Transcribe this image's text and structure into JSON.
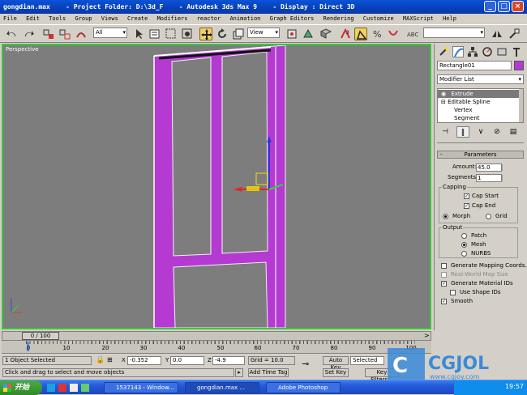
{
  "window": {
    "title": "gongdian.max    - Project Folder: D:\\3d_F    - Autodesk 3ds Max 9    - Display : Direct 3D",
    "min": "_",
    "max": "□",
    "close": "×"
  },
  "menu": [
    "File",
    "Edit",
    "Tools",
    "Group",
    "Views",
    "Create",
    "Modifiers",
    "reactor",
    "Animation",
    "Graph Editors",
    "Rendering",
    "Customize",
    "MAXScript",
    "Help"
  ],
  "toolbar": {
    "selection_filter": "All",
    "ref_coord": "View"
  },
  "viewport": {
    "label": "Perspective"
  },
  "command_panel": {
    "object_name": "Rectangle01",
    "modifier_list": "Modifier List",
    "stack": [
      "Extrude",
      "Editable Spline",
      "Vertex",
      "Segment"
    ],
    "rollout_title": "Parameters",
    "amount_label": "Amount:",
    "amount_value": "45.0",
    "segments_label": "Segments:",
    "segments_value": "1",
    "capping_title": "Capping",
    "cap_start": "Cap Start",
    "cap_end": "Cap End",
    "morph": "Morph",
    "grid": "Grid",
    "output_title": "Output",
    "patch": "Patch",
    "mesh": "Mesh",
    "nurbs": "NURBS",
    "gen_mapping": "Generate Mapping Coords.",
    "real_world": "Real-World Map Size",
    "gen_mat_ids": "Generate Material IDs",
    "use_shape_ids": "Use Shape IDs",
    "smooth": "Smooth"
  },
  "timeline": {
    "frame": "0 / 100",
    "ticks": [
      "0",
      "10",
      "20",
      "30",
      "40",
      "50",
      "60",
      "70",
      "80",
      "90",
      "100"
    ]
  },
  "status": {
    "selected": "1 Object Selected",
    "prompt": "Click and drag to select and move objects",
    "x_label": "X",
    "x_value": "-0.352",
    "y_label": "Y",
    "y_value": "0.0",
    "z_label": "Z",
    "z_value": "-4.9",
    "grid": "Grid = 10.0",
    "add_time_tag": "Add Time Tag",
    "auto_key": "Auto Key",
    "set_key": "Set Key",
    "key_mode": "Selected",
    "key_filters": "Key Filters..."
  },
  "taskbar": {
    "start": "开始",
    "tasks": [
      "1537143 - Window...",
      "gongdian.max ...",
      "Adobe Photoshop"
    ],
    "clock": "19:57"
  },
  "watermark": {
    "logo": "CGJOL",
    "url": "www.cgjoy.com"
  },
  "colors": {
    "viewport_border": "#38c838",
    "object": "#b43ad2",
    "viewport_bg": "#7d7d7d"
  }
}
